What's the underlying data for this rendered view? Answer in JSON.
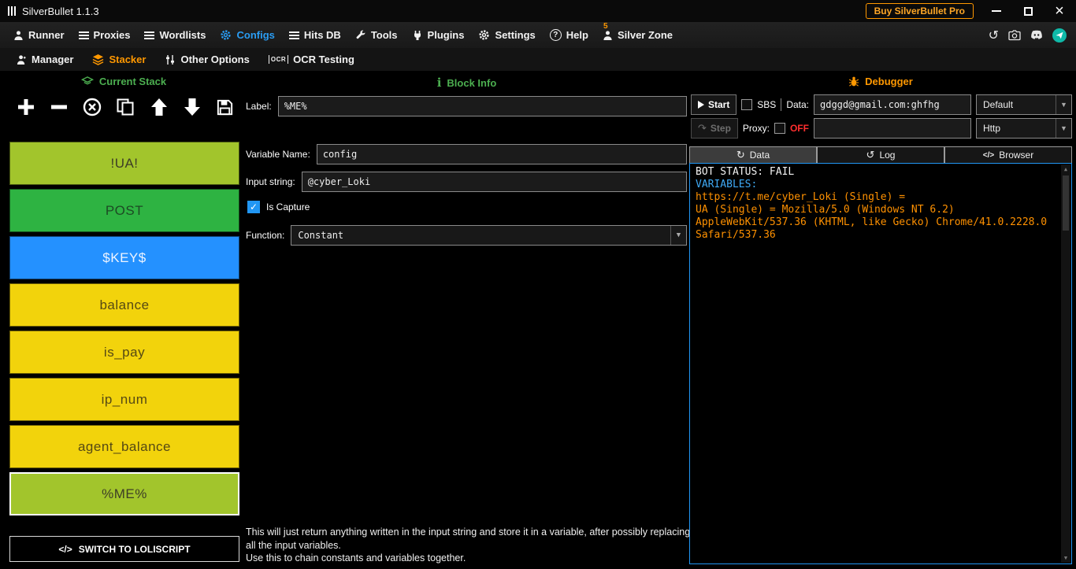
{
  "window": {
    "title": "SilverBullet 1.1.3",
    "buy_pro": "Buy SilverBullet Pro"
  },
  "menubar": {
    "items": [
      {
        "label": "Runner"
      },
      {
        "label": "Proxies"
      },
      {
        "label": "Wordlists"
      },
      {
        "label": "Configs",
        "active": true
      },
      {
        "label": "Hits DB"
      },
      {
        "label": "Tools"
      },
      {
        "label": "Plugins"
      },
      {
        "label": "Settings"
      },
      {
        "label": "Help"
      },
      {
        "label": "Silver Zone",
        "badge": "5"
      }
    ]
  },
  "submenu": {
    "items": [
      {
        "label": "Manager"
      },
      {
        "label": "Stacker",
        "active": true
      },
      {
        "label": "Other Options"
      },
      {
        "label": "OCR Testing"
      }
    ]
  },
  "icons": {
    "ocr_glyph": "OCR",
    "code_glyph": "</>",
    "browser_glyph": "</>"
  },
  "stack": {
    "header": "Current Stack",
    "blocks": [
      {
        "label": "!UA!",
        "color": "#a2c52c",
        "text_color": "#3d3d26",
        "selected": false
      },
      {
        "label": "POST",
        "color": "#2eb342",
        "text_color": "#1d4a24",
        "selected": false
      },
      {
        "label": "$KEY$",
        "color": "#2491ff",
        "text_color": "#eef4ff",
        "selected": false
      },
      {
        "label": "balance",
        "color": "#f2d30c",
        "text_color": "#554914",
        "selected": false
      },
      {
        "label": "is_pay",
        "color": "#f2d30c",
        "text_color": "#554914",
        "selected": false
      },
      {
        "label": "ip_num",
        "color": "#f2d30c",
        "text_color": "#554914",
        "selected": false
      },
      {
        "label": "agent_balance",
        "color": "#f2d30c",
        "text_color": "#554914",
        "selected": false
      },
      {
        "label": "%ME%",
        "color": "#a2c52c",
        "text_color": "#3d3d26",
        "selected": true
      }
    ],
    "switch_label": "SWITCH TO LOLISCRIPT"
  },
  "block_info": {
    "header": "Block Info",
    "label_label": "Label:",
    "label_value": "%ME%",
    "variable_name_label": "Variable Name:",
    "variable_name_value": "config",
    "input_string_label": "Input string:",
    "input_string_value": "@cyber_Loki",
    "is_capture_label": "Is Capture",
    "function_label": "Function:",
    "function_value": "Constant",
    "description_line1": "This will just return anything written in the input string and store it in a variable, after possibly replacing all the input variables.",
    "description_line2": "Use this to chain constants and variables together."
  },
  "debugger": {
    "header": "Debugger",
    "start_label": "Start",
    "sbs_label": "SBS",
    "data_label": "Data:",
    "data_value": "gdggd@gmail.com:ghfhg",
    "wordlist_type": "Default",
    "step_label": "Step",
    "proxy_label": "Proxy:",
    "proxy_status": "OFF",
    "proxy_value": "",
    "proxy_type": "Http",
    "tabs": [
      {
        "label": "Data",
        "active": true
      },
      {
        "label": "Log",
        "active": false
      },
      {
        "label": "Browser",
        "active": false
      }
    ],
    "log": [
      {
        "text": "BOT STATUS: FAIL",
        "color": "#f2f2f2"
      },
      {
        "text": "VARIABLES:",
        "color": "#3fa9f5"
      },
      {
        "text": "https://t.me/cyber_Loki (Single) = ",
        "color": "#ff9100"
      },
      {
        "text": "UA (Single) = Mozilla/5.0 (Windows NT 6.2)",
        "color": "#ff9100"
      },
      {
        "text": "AppleWebKit/537.36 (KHTML, like Gecko) Chrome/41.0.2228.0",
        "color": "#ff9100"
      },
      {
        "text": "Safari/537.36",
        "color": "#ff9100"
      }
    ]
  },
  "colors": {
    "accent_blue": "#2a9df4",
    "accent_orange": "#ff9800",
    "accent_green": "#4caf50",
    "error_red": "#ff2e2e",
    "debug_border": "#2196f3"
  }
}
